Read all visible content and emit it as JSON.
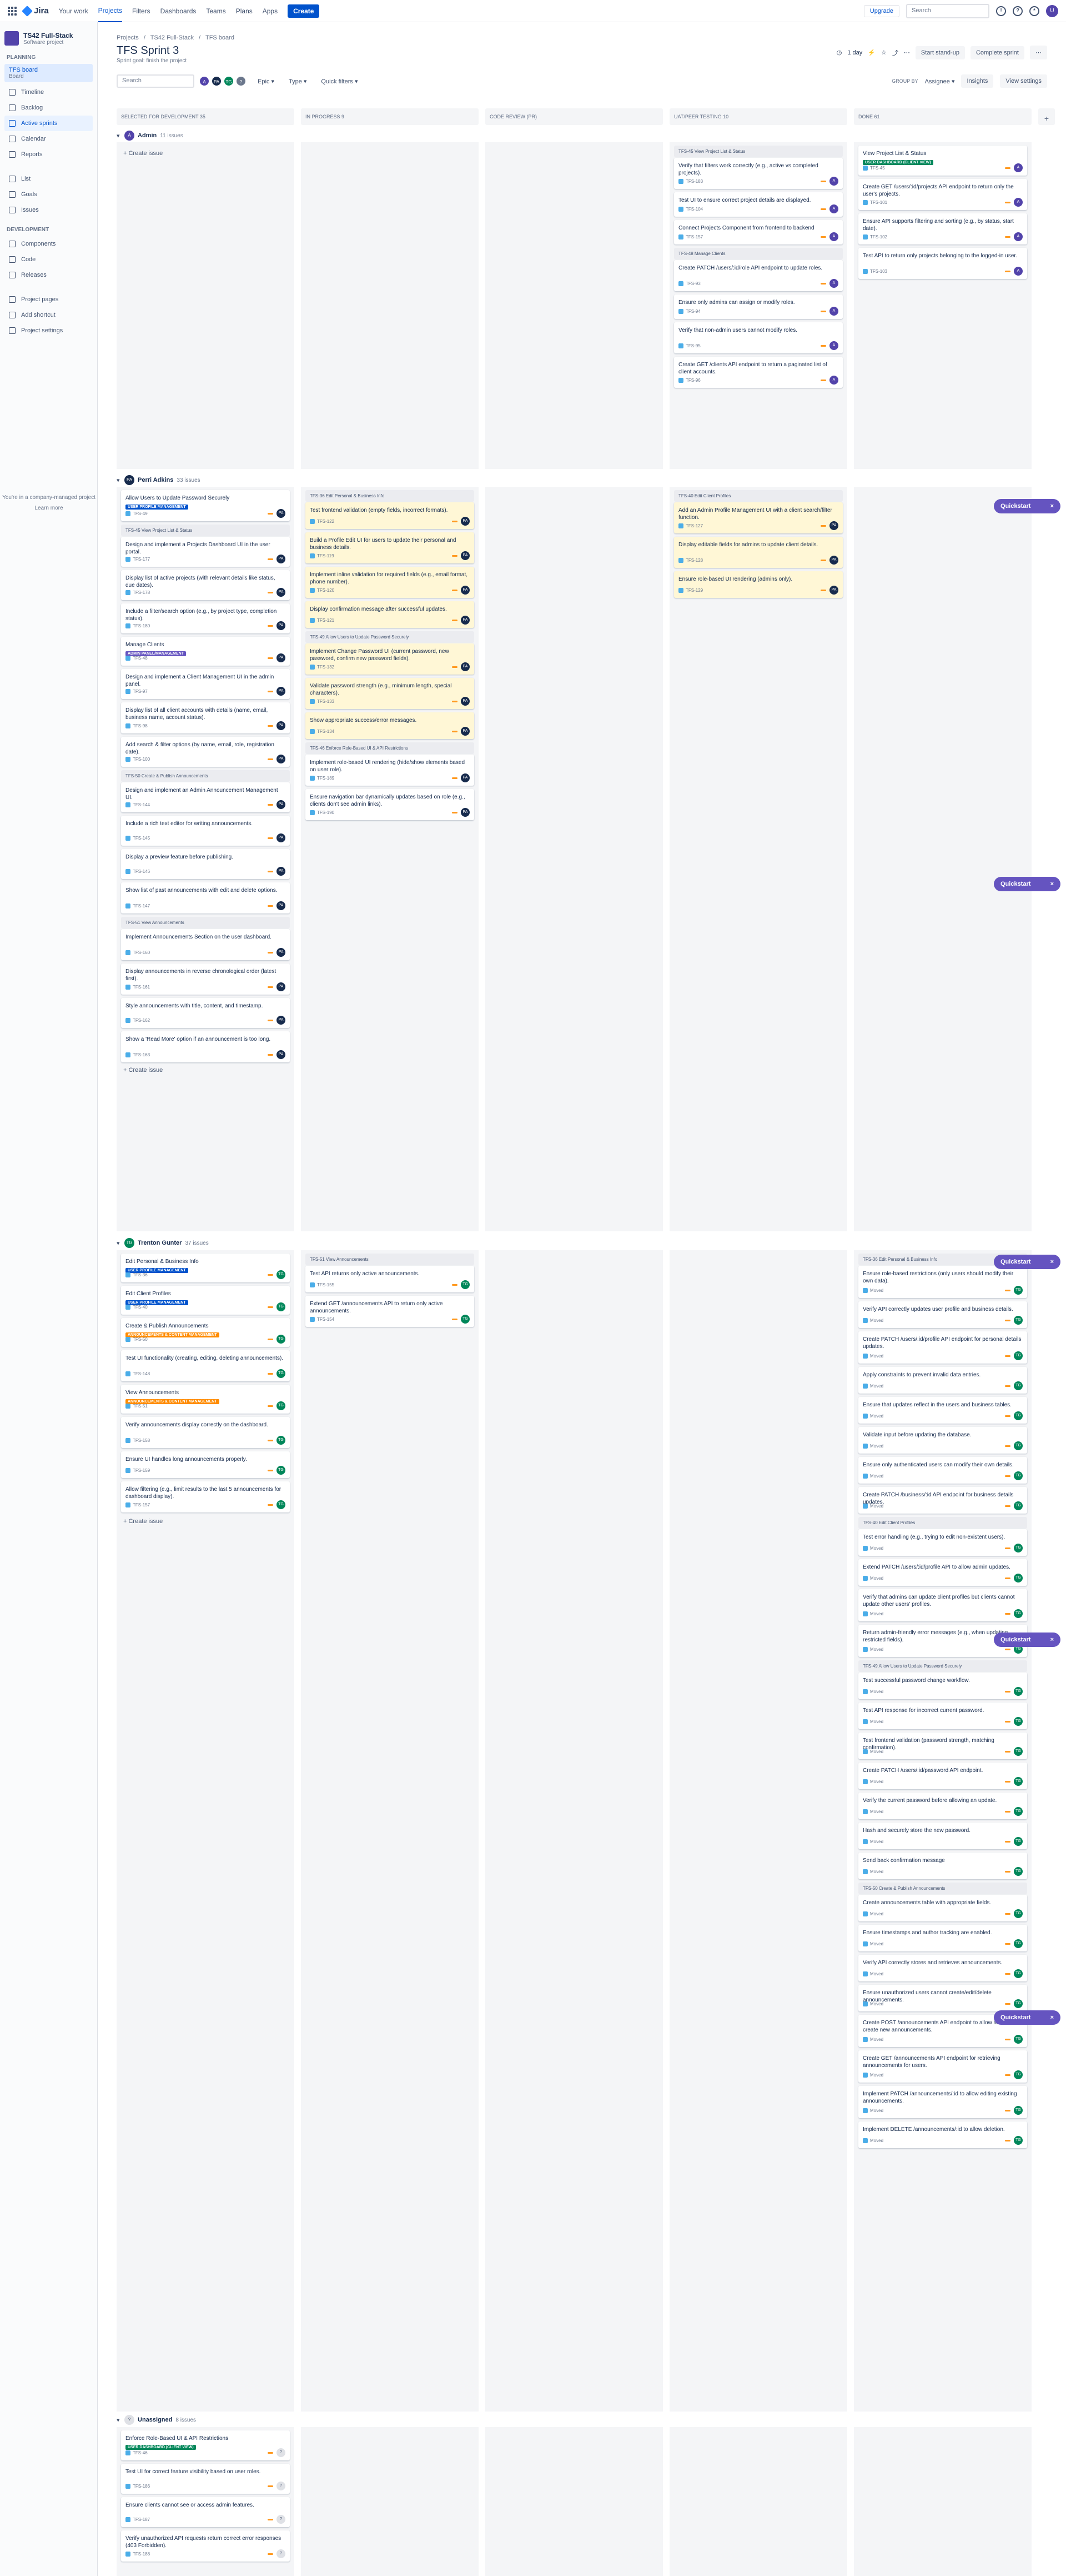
{
  "topbar": {
    "logo": "Jira",
    "nav": [
      "Your work",
      "Projects",
      "Filters",
      "Dashboards",
      "Teams",
      "Plans",
      "Apps"
    ],
    "create": "Create",
    "upgrade": "Upgrade",
    "search_placeholder": "Search"
  },
  "sidebar": {
    "project_name": "TS42 Full-Stack",
    "project_type": "Software project",
    "section_planning": "PLANNING",
    "board_title": "TFS board",
    "board_sub": "Board",
    "items": [
      "Timeline",
      "Backlog",
      "Active sprints",
      "Calendar",
      "Reports",
      "List",
      "Goals",
      "Issues"
    ],
    "section_dev": "DEVELOPMENT",
    "dev_items": [
      "Components",
      "Code",
      "Releases"
    ],
    "other_items": [
      "Project pages",
      "Add shortcut",
      "Project settings"
    ],
    "footer": "You're in a company-managed project",
    "learn_more": "Learn more"
  },
  "header": {
    "breadcrumb": [
      "Projects",
      "/",
      "TS42 Full-Stack",
      "/",
      "TFS board"
    ],
    "title": "TFS Sprint 3",
    "goal": "Sprint goal: finish the project",
    "days": "1 day",
    "start_standup": "Start stand-up",
    "complete_sprint": "Complete sprint"
  },
  "filters": {
    "search_placeholder": "Search",
    "epic": "Epic",
    "type": "Type",
    "quick": "Quick filters",
    "group_by": "GROUP BY",
    "group_value": "Assignee",
    "insights": "Insights",
    "view_settings": "View settings"
  },
  "columns": [
    "SELECTED FOR DEVELOPMENT 35",
    "IN PROGRESS 9",
    "CODE REVIEW (PR)",
    "UAT/PEER TESTING 10",
    "DONE 61"
  ],
  "lanes": {
    "admin": {
      "name": "Admin",
      "count": "11 issues"
    },
    "perri": {
      "name": "Perri Adkins",
      "count": "33 issues"
    },
    "trenton": {
      "name": "Trenton Gunter",
      "count": "37 issues"
    },
    "unassigned": {
      "name": "Unassigned",
      "count": "8 issues"
    }
  },
  "create_issue": "+ Create issue",
  "quickstart": "Quickstart",
  "cards": {
    "admin_uat": [
      "Verify that filters work correctly (e.g., active vs completed projects).",
      "Test UI to ensure correct project details are displayed.",
      "Connect Projects Component from frontend to backend",
      "Create PATCH /users/:id/role API endpoint to update roles.",
      "Ensure only admins can assign or modify roles.",
      "Verify that non-admin users cannot modify roles.",
      "Create GET /clients API endpoint to return a paginated list of client accounts."
    ],
    "admin_done": [
      "View Project List & Status",
      "Create GET /users/:id/projects API endpoint to return only the user's projects.",
      "Ensure API supports filtering and sorting (e.g., by status, start date).",
      "Test API to return only projects belonging to the logged-in user."
    ],
    "perri_sel": [
      "Allow Users to Update Password Securely",
      "Design and implement a Projects Dashboard UI in the user portal.",
      "Display list of active projects (with relevant details like status, due dates).",
      "Include a filter/search option (e.g., by project type, completion status).",
      "Manage Clients",
      "Design and implement a Client Management UI in the admin panel.",
      "Display list of all client accounts with details (name, email, business name, account status).",
      "Add search & filter options (by name, email, role, registration date).",
      "Design and implement an Admin Announcement Management UI.",
      "Include a rich text editor for writing announcements.",
      "Display a preview feature before publishing.",
      "Show list of past announcements with edit and delete options.",
      "Implement Announcements Section on the user dashboard.",
      "Display announcements in reverse chronological order (latest first).",
      "Style announcements with title, content, and timestamp.",
      "Show a 'Read More' option if an announcement is too long."
    ],
    "perri_prog": [
      "Test frontend validation (empty fields, incorrect formats).",
      "Build a Profile Edit UI for users to update their personal and business details.",
      "Implement inline validation for required fields (e.g., email format, phone number).",
      "Display confirmation message after successful updates.",
      "Implement Change Password UI (current password, new password, confirm new password fields).",
      "Validate password strength (e.g., minimum length, special characters).",
      "Show appropriate success/error messages.",
      "Implement role-based UI rendering (hide/show elements based on user role).",
      "Ensure navigation bar dynamically updates based on role (e.g., clients don't see admin links)."
    ],
    "perri_uat": [
      "Add an Admin Profile Management UI with a client search/filter function.",
      "Display editable fields for admins to update client details.",
      "Ensure role-based UI rendering (admins only)."
    ],
    "trenton_sel": [
      "Edit Personal & Business Info",
      "Edit Client Profiles",
      "Create & Publish Announcements",
      "Test UI functionality (creating, editing, deleting announcements).",
      "View Announcements",
      "Verify announcements display correctly on the dashboard.",
      "Ensure UI handles long announcements properly.",
      "Allow filtering (e.g., limit results to the last 5 announcements for dashboard display)."
    ],
    "trenton_prog": [
      "Test API returns only active announcements.",
      "Extend GET /announcements API to return only active announcements."
    ],
    "trenton_done": [
      "Ensure role-based restrictions (only users should modify their own data).",
      "Verify API correctly updates user profile and business details.",
      "Create PATCH /users/:id/profile API endpoint for personal details updates.",
      "Apply constraints to prevent invalid data entries.",
      "Ensure that updates reflect in the users and business tables.",
      "Validate input before updating the database.",
      "Ensure only authenticated users can modify their own details.",
      "Create PATCH /business/:id API endpoint for business details updates.",
      "Test error handling (e.g., trying to edit non-existent users).",
      "Extend PATCH /users/:id/profile API to allow admin updates.",
      "Verify that admins can update client profiles but clients cannot update other users' profiles.",
      "Return admin-friendly error messages (e.g., when updating restricted fields).",
      "Test successful password change workflow.",
      "Test API response for incorrect current password.",
      "Test frontend validation (password strength, matching confirmation).",
      "Create PATCH /users/:id/password API endpoint.",
      "Verify the current password before allowing an update.",
      "Hash and securely store the new password.",
      "Send back confirmation message",
      "Create announcements table with appropriate fields.",
      "Ensure timestamps and author tracking are enabled.",
      "Verify API correctly stores and retrieves announcements.",
      "Ensure unauthorized users cannot create/edit/delete announcements.",
      "Create POST /announcements API endpoint to allow admins to create new announcements.",
      "Create GET /announcements API endpoint for retrieving announcements for users.",
      "Implement PATCH /announcements/:id to allow editing existing announcements.",
      "Implement DELETE /announcements/:id to allow deletion."
    ],
    "unassigned_sel": [
      "Enforce Role-Based UI & API Restrictions",
      "Test UI for correct feature visibility based on user roles.",
      "Ensure clients cannot see or access admin features.",
      "Verify unauthorized API requests return correct error responses (403 Forbidden)."
    ]
  },
  "colors": {
    "accent": "#0052cc",
    "done": "#00875a",
    "purple": "#5243aa",
    "yellow": "#fff7d6"
  }
}
